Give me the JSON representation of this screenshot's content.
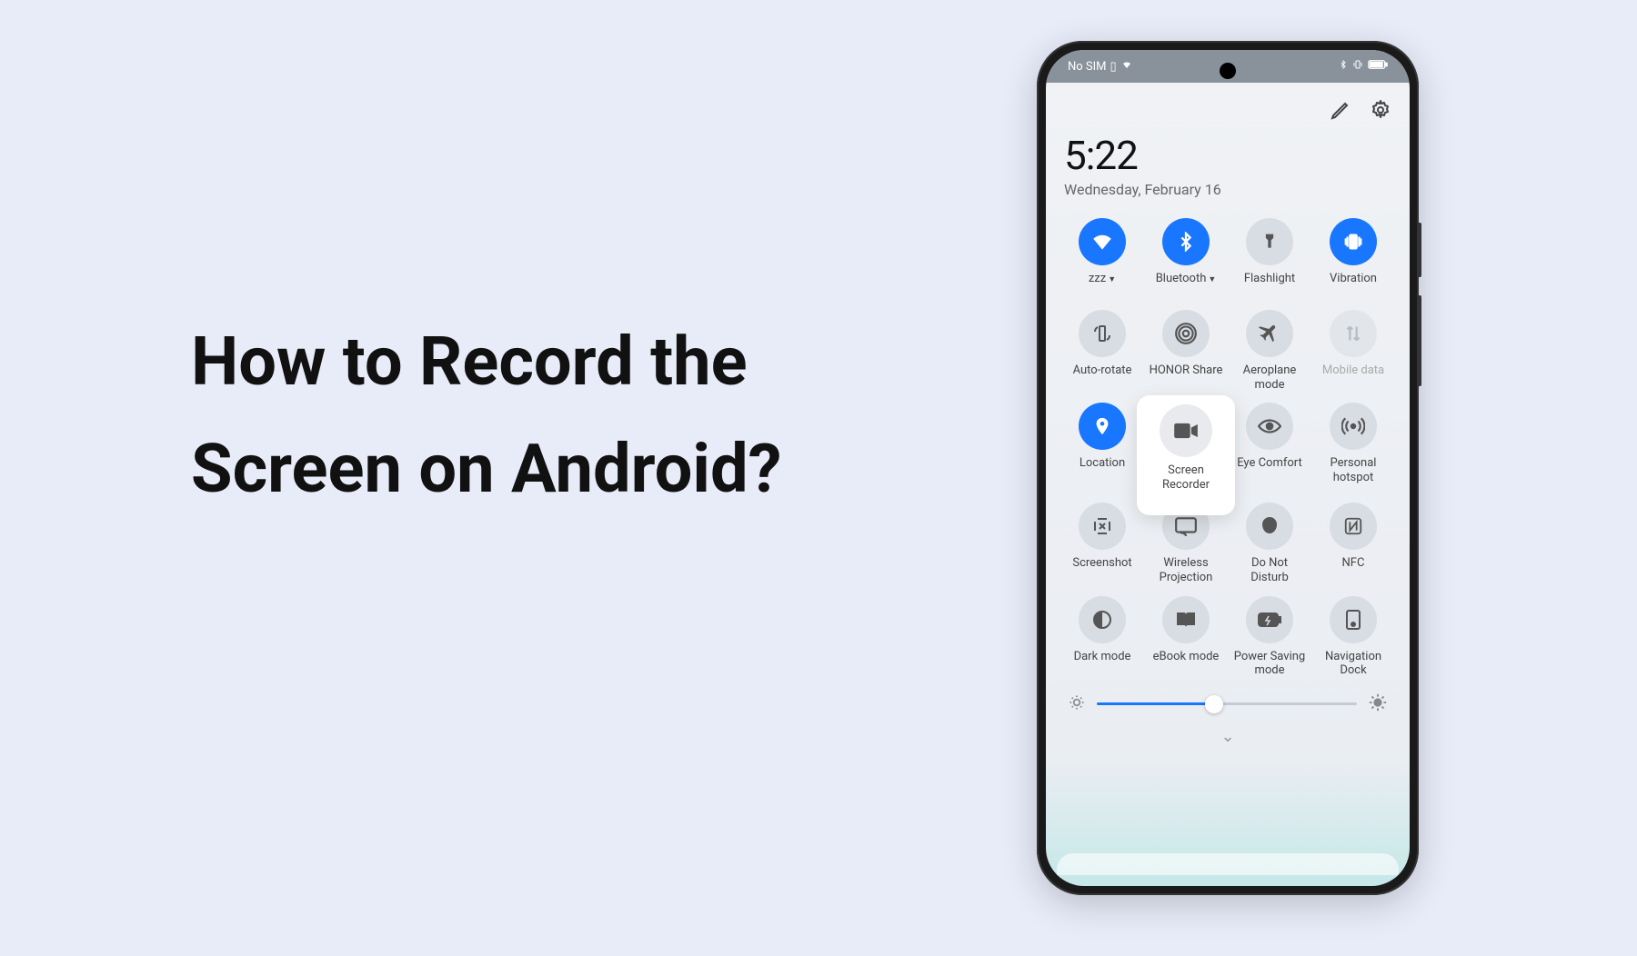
{
  "headline": {
    "line1": "How to Record the",
    "line2": "Screen on Android?"
  },
  "statusBar": {
    "noSim": "No SIM",
    "bluetoothIcon": "✱",
    "vibrateIcon": "⟐",
    "batteryIcon": "▮"
  },
  "clock": {
    "time": "5:22",
    "date": "Wednesday, February 16"
  },
  "tiles": {
    "wifi": {
      "label": "zzz"
    },
    "bluetooth": {
      "label": "Bluetooth"
    },
    "flashlight": {
      "label": "Flashlight"
    },
    "vibration": {
      "label": "Vibration"
    },
    "autorotate": {
      "label": "Auto-rotate"
    },
    "honorshare": {
      "label": "HONOR Share"
    },
    "aeroplane": {
      "label": "Aeroplane mode"
    },
    "mobiledata": {
      "label": "Mobile data"
    },
    "location": {
      "label": "Location"
    },
    "screenrecorder": {
      "label": "Screen Recorder"
    },
    "eyecomfort": {
      "label": "Eye Comfort"
    },
    "hotspot": {
      "label": "Personal hotspot"
    },
    "screenshot": {
      "label": "Screenshot"
    },
    "wirelessproj": {
      "label": "Wireless Projection"
    },
    "dnd": {
      "label": "Do Not Disturb"
    },
    "nfc": {
      "label": "NFC"
    },
    "darkmode": {
      "label": "Dark mode"
    },
    "ebook": {
      "label": "eBook mode"
    },
    "powersaving": {
      "label": "Power Saving mode"
    },
    "navdock": {
      "label": "Navigation Dock"
    }
  },
  "brightness": {
    "percent": 45
  }
}
